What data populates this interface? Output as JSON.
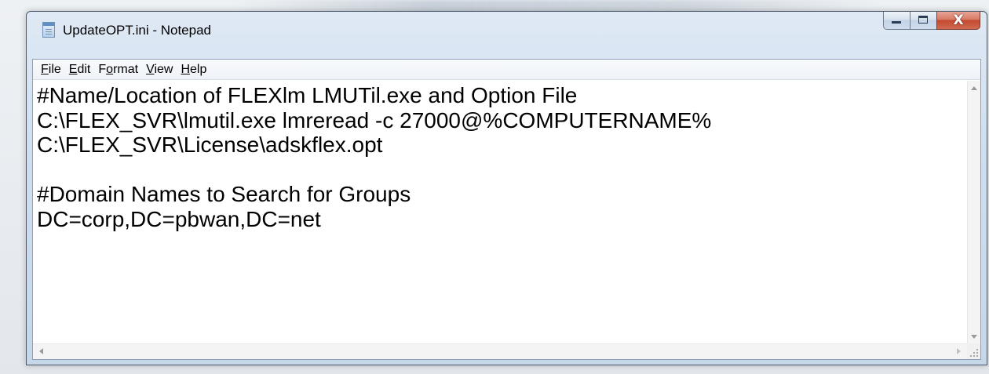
{
  "window": {
    "title": "UpdateOPT.ini - Notepad",
    "close_glyph": "X",
    "icons": {
      "app": "notepad-icon",
      "minimize": "minimize-icon",
      "maximize": "maximize-icon",
      "close": "close-icon"
    }
  },
  "menu": {
    "items": [
      {
        "accel": "F",
        "rest": "ile"
      },
      {
        "accel": "E",
        "rest": "dit"
      },
      {
        "pre": "F",
        "accel": "o",
        "rest": "rmat"
      },
      {
        "accel": "V",
        "rest": "iew"
      },
      {
        "accel": "H",
        "rest": "elp"
      }
    ]
  },
  "editor": {
    "lines": [
      "#Name/Location of FLEXlm LMUTil.exe and Option File",
      "C:\\FLEX_SVR\\lmutil.exe lmreread -c 27000@%COMPUTERNAME%",
      "C:\\FLEX_SVR\\License\\adskflex.opt",
      "",
      "#Domain Names to Search for Groups",
      "DC=corp,DC=pbwan,DC=net"
    ]
  },
  "colors": {
    "close_button": "#c44a2f",
    "frame": "#cfdff0"
  }
}
